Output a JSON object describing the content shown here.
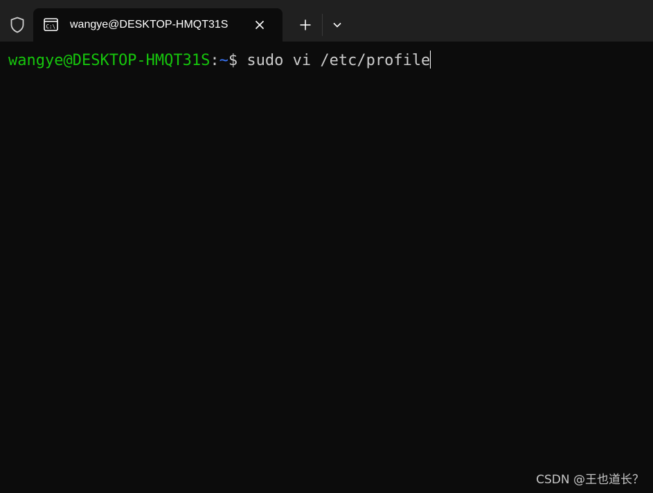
{
  "tab": {
    "title": "wangye@DESKTOP-HMQT31S",
    "icon": "terminal-icon",
    "close_icon": "close-icon"
  },
  "toolbar": {
    "shield_icon": "shield-icon",
    "new_tab_icon": "plus-icon",
    "dropdown_icon": "chevron-down-icon"
  },
  "terminal": {
    "user_host": "wangye@DESKTOP-HMQT31S",
    "separator": ":",
    "path": "~",
    "prompt_symbol": "$",
    "command": " sudo vi /etc/profile"
  },
  "watermark": "CSDN @王也道长？",
  "colors": {
    "background": "#0c0c0c",
    "titlebar": "#202020",
    "prompt_user": "#16c60c",
    "prompt_path": "#3b78ff",
    "text": "#cccccc"
  }
}
